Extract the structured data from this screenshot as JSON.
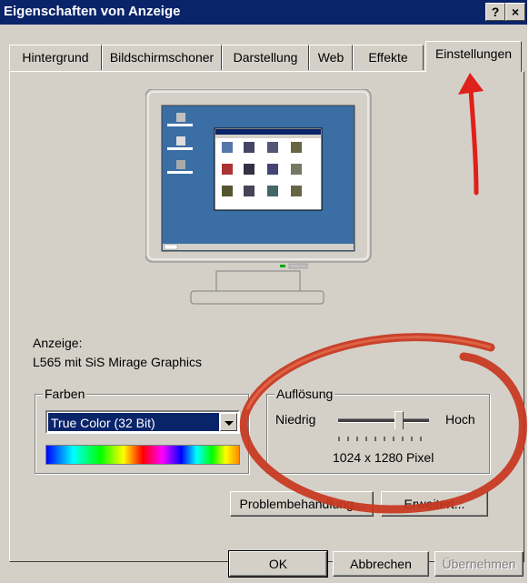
{
  "window": {
    "title": "Eigenschaften von Anzeige",
    "help_btn": "?",
    "close_btn": "×"
  },
  "tabs": [
    {
      "label": "Hintergrund"
    },
    {
      "label": "Bildschirmschoner"
    },
    {
      "label": "Darstellung"
    },
    {
      "label": "Web"
    },
    {
      "label": "Effekte"
    },
    {
      "label": "Einstellungen"
    }
  ],
  "display": {
    "label": "Anzeige:",
    "value": "L565 mit SiS Mirage Graphics"
  },
  "colors": {
    "legend": "Farben",
    "selected": "True Color (32 Bit)"
  },
  "resolution": {
    "legend": "Auflösung",
    "low": "Niedrig",
    "high": "Hoch",
    "value": "1024 x 1280 Pixel",
    "slider_fraction": 0.7
  },
  "buttons": {
    "troubleshoot": "Problembehandlung...",
    "advanced": "Erweitert...",
    "ok": "OK",
    "cancel": "Abbrechen",
    "apply": "Übernehmen"
  },
  "annotation_colors": {
    "arrow": "#e0201a",
    "ellipse": "#c8351e"
  }
}
